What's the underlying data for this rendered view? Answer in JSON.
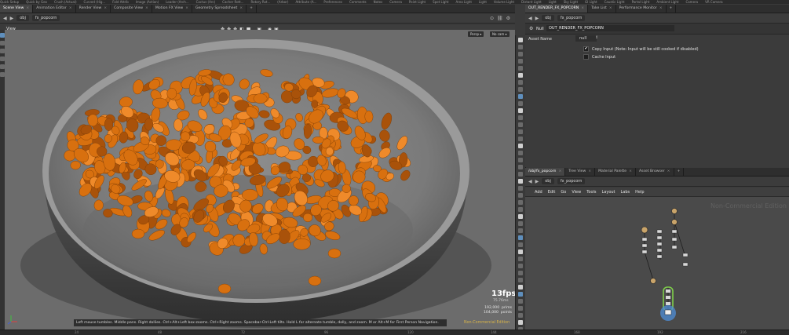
{
  "shelf": {
    "items": [
      "Quick Setup",
      "Quick by Geo",
      "Crush (Actual)",
      "Curved (Hig...",
      "Fold Attrib",
      "Image (Action)",
      "Loader (Arch...",
      "Cactus (Arc)",
      "Cacher Rott...",
      "Rotary Rot...",
      "(Arbor)",
      "Attribute (A...",
      "Preferences",
      "Comments",
      "Notes",
      "Camera",
      "Point Light",
      "Spot Light",
      "Area Light",
      "Light",
      "Volume Light",
      "Distant Light",
      "Light",
      "Sky Light",
      "GI Light",
      "Caustic Light",
      "Portal Light",
      "Ambient Light",
      "Camera",
      "VR Camera"
    ]
  },
  "left_tabs": [
    {
      "label": "Scene View",
      "active": true
    },
    {
      "label": "Animation Editor"
    },
    {
      "label": "Render View"
    },
    {
      "label": "Composite View"
    },
    {
      "label": "Motion FX View"
    },
    {
      "label": "Geometry Spreadsheet"
    }
  ],
  "left_path": {
    "obj": "obj",
    "node": "fx_popcorn"
  },
  "viewport": {
    "title": "View",
    "persp": "Persp",
    "cam": "No cam",
    "fps": "13fps",
    "ms": "75.76ms",
    "prims": "192,000  prims",
    "points": "104,000  points",
    "status": "Left mouse tumbles. Middle pans. Right dollies. Ctrl+Alt+Left box-zooms. Ctrl+Right zooms. Spacebar-Ctrl-Left tilts. Hold L for alternate tumble, dolly, and zoom.    M or Alt+M for First Person Navigation.",
    "non_commercial": "Non-Commercial Edition"
  },
  "right_tabs": [
    {
      "label": "OUT_RENDER_FX_POPCORN",
      "active": true
    },
    {
      "label": "Take List"
    },
    {
      "label": "Performance Monitor"
    }
  ],
  "right_path": {
    "obj": "obj",
    "node": "fx_popcorn"
  },
  "params": {
    "node_type": "Null",
    "node_name": "OUT_RENDER_FX_POPCORN",
    "asset_label": "Asset Name",
    "asset_value": "null",
    "copy_input": "Copy Input (Note: Input will be still cooked if disabled)",
    "copy_input_checked": true,
    "cache_input": "Cache Input",
    "cache_input_checked": false
  },
  "net_tabs": [
    {
      "label": "/obj/fx_popcorn",
      "active": true
    },
    {
      "label": "Tree View"
    },
    {
      "label": "Material Palette"
    },
    {
      "label": "Asset Browser"
    }
  ],
  "net_path": {
    "obj": "obj",
    "node": "fx_popcorn"
  },
  "net_menu": [
    "Add",
    "Edit",
    "Go",
    "View",
    "Tools",
    "Layout",
    "Labs",
    "Help"
  ],
  "net_watermark": "Non-Commercial Edition",
  "timeline": {
    "ticks": [
      "24",
      "48",
      "72",
      "96",
      "120",
      "144",
      "168",
      "192",
      "216"
    ]
  },
  "colors": {
    "popcorn": "#d8700f",
    "viewport_bg": "#6c6c6c",
    "node_selected": "#7fcf4a",
    "node_highlight": "#4f8fd8"
  }
}
